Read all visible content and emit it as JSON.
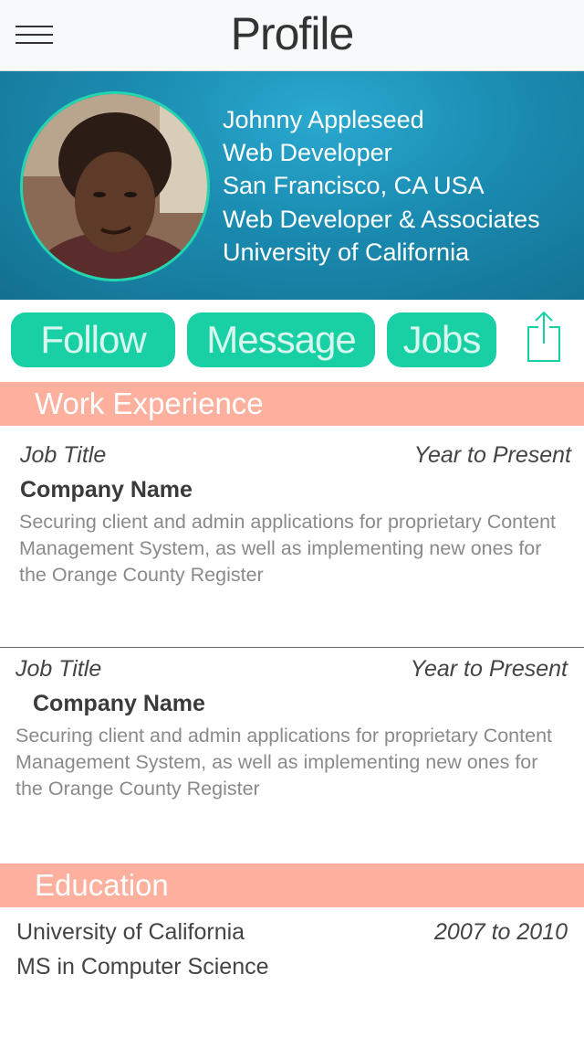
{
  "nav": {
    "title": "Profile",
    "menu_icon": "hamburger-menu-icon"
  },
  "profile": {
    "name": "Johnny Appleseed",
    "role": "Web Developer",
    "location": "San Francisco, CA  USA",
    "company": "Web Developer & Associates",
    "school": "University of California",
    "header_color": "#1a8ab0",
    "avatar_ring_color": "#22d6b0"
  },
  "actions": {
    "follow_label": "Follow",
    "message_label": "Message",
    "jobs_label": "Jobs",
    "share_icon": "share-icon",
    "button_color": "#18d0a4"
  },
  "work": {
    "section_title": "Work Experience",
    "section_color": "#fdb09d",
    "jobs": [
      {
        "title": "Job Title",
        "years": "Year to Present",
        "company": "Company Name",
        "description": "Securing client and admin applications for proprietary Content Management System, as well as implementing new ones for the Orange County Register"
      },
      {
        "title": "Job Title",
        "years": "Year to Present",
        "company": "Company Name",
        "description": "Securing client and admin applications for proprietary Content Management System, as well as implementing new ones for the Orange County Register"
      }
    ]
  },
  "education": {
    "section_title": "Education",
    "school": "University of California",
    "years": "2007 to 2010",
    "degree": "MS in Computer Science"
  }
}
